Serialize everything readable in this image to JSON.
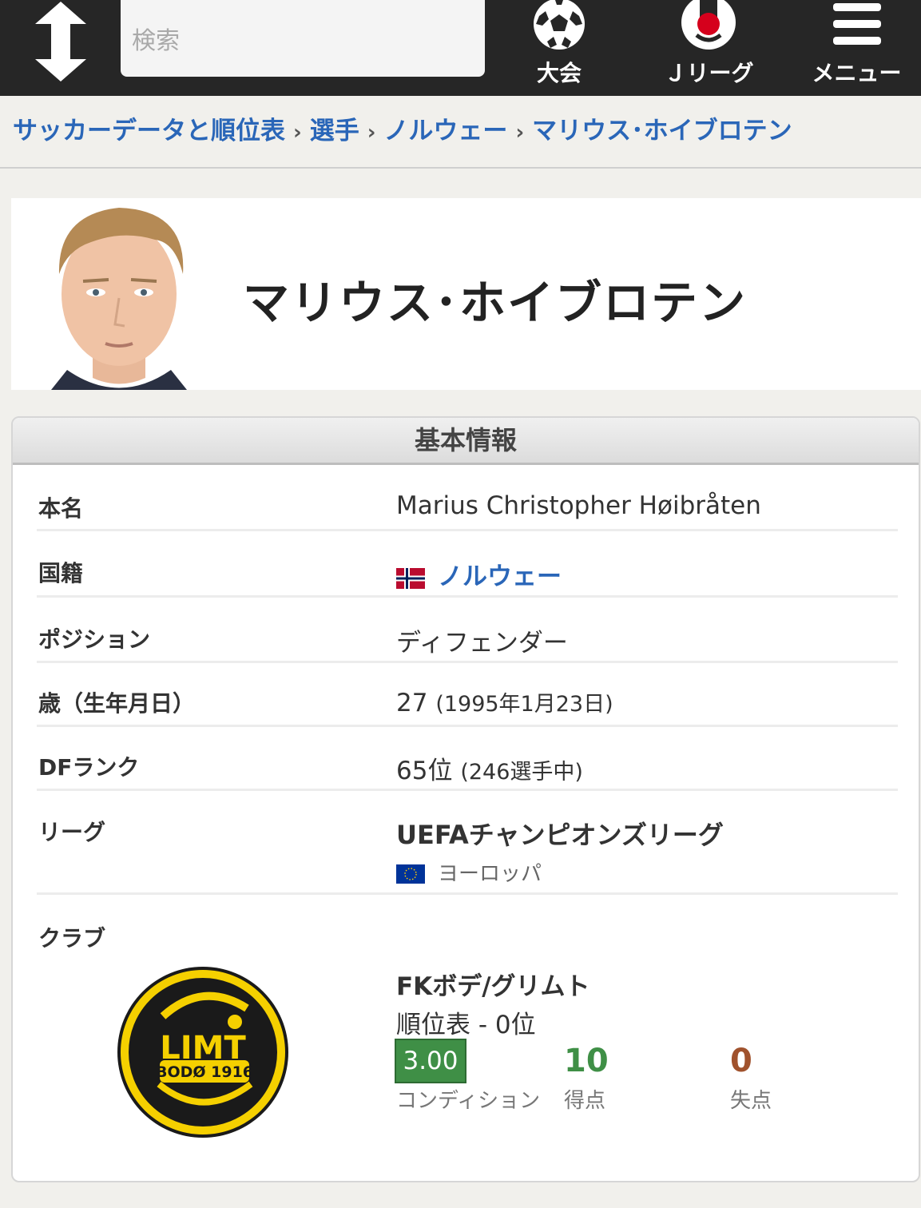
{
  "header": {
    "search_placeholder": "検索",
    "nav": [
      {
        "label": "大会",
        "icon": "soccer-ball-icon"
      },
      {
        "label": "Ｊリーグ",
        "icon": "jleague-logo-icon"
      },
      {
        "label": "メニュー",
        "icon": "hamburger-menu-icon"
      }
    ]
  },
  "breadcrumb": [
    "サッカーデータと順位表",
    "選手",
    "ノルウェー",
    "マリウス･ホイブロテン"
  ],
  "breadcrumb_separator": "›",
  "player": {
    "name": "マリウス･ホイブロテン"
  },
  "info": {
    "section_title": "基本情報",
    "full_name_label": "本名",
    "full_name": "Marius Christopher Høibråten",
    "nationality_label": "国籍",
    "nationality": "ノルウェー",
    "position_label": "ポジション",
    "position": "ディフェンダー",
    "age_label": "歳（生年月日）",
    "age": "27",
    "birthdate": "(1995年1月23日)",
    "rank_label": "DFランク",
    "rank": "65位",
    "rank_note": "(246選手中)",
    "league_label": "リーグ",
    "league": "UEFAチャンピオンズリーグ",
    "league_region": "ヨーロッパ",
    "club_label": "クラブ",
    "club": "FKボデ/グリムト",
    "standing": "順位表 - 0位",
    "condition": "3.00",
    "condition_label": "コンディション",
    "goals_for": "10",
    "goals_for_label": "得点",
    "goals_against": "0",
    "goals_against_label": "失点",
    "club_logo_text_top": "LIMT",
    "club_logo_text_bottom": "BODØ 1916"
  },
  "colors": {
    "header_bg": "#262626",
    "link": "#2a66b8",
    "condition_badge": "#3f8f46",
    "goals_for": "#3f8f46",
    "goals_against": "#a0522d",
    "club_logo_yellow": "#f5d000"
  }
}
